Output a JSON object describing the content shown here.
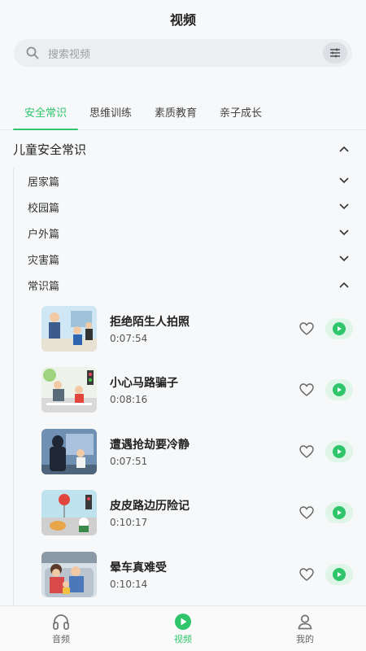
{
  "header": {
    "title": "视频"
  },
  "search": {
    "placeholder": "搜索视频"
  },
  "tabs": [
    {
      "label": "安全常识",
      "active": true
    },
    {
      "label": "思维训练",
      "active": false
    },
    {
      "label": "素质教育",
      "active": false
    },
    {
      "label": "亲子成长",
      "active": false
    }
  ],
  "section": {
    "title": "儿童安全常识",
    "expanded": true
  },
  "subcategories": [
    {
      "label": "居家篇",
      "expanded": false
    },
    {
      "label": "校园篇",
      "expanded": false
    },
    {
      "label": "户外篇",
      "expanded": false
    },
    {
      "label": "灾害篇",
      "expanded": false
    },
    {
      "label": "常识篇",
      "expanded": true
    }
  ],
  "videos": [
    {
      "title": "拒绝陌生人拍照",
      "duration": "0:07:54"
    },
    {
      "title": "小心马路骗子",
      "duration": "0:08:16"
    },
    {
      "title": "遭遇抢劫要冷静",
      "duration": "0:07:51"
    },
    {
      "title": "皮皮路边历险记",
      "duration": "0:10:17"
    },
    {
      "title": "晕车真难受",
      "duration": "0:10:14"
    }
  ],
  "nav": [
    {
      "label": "音频",
      "icon": "headphones-icon",
      "active": false
    },
    {
      "label": "视频",
      "icon": "play-circle-icon",
      "active": true
    },
    {
      "label": "我的",
      "icon": "user-icon",
      "active": false
    }
  ],
  "colors": {
    "accent": "#2ec56b",
    "accent_light": "#dff5e8"
  }
}
